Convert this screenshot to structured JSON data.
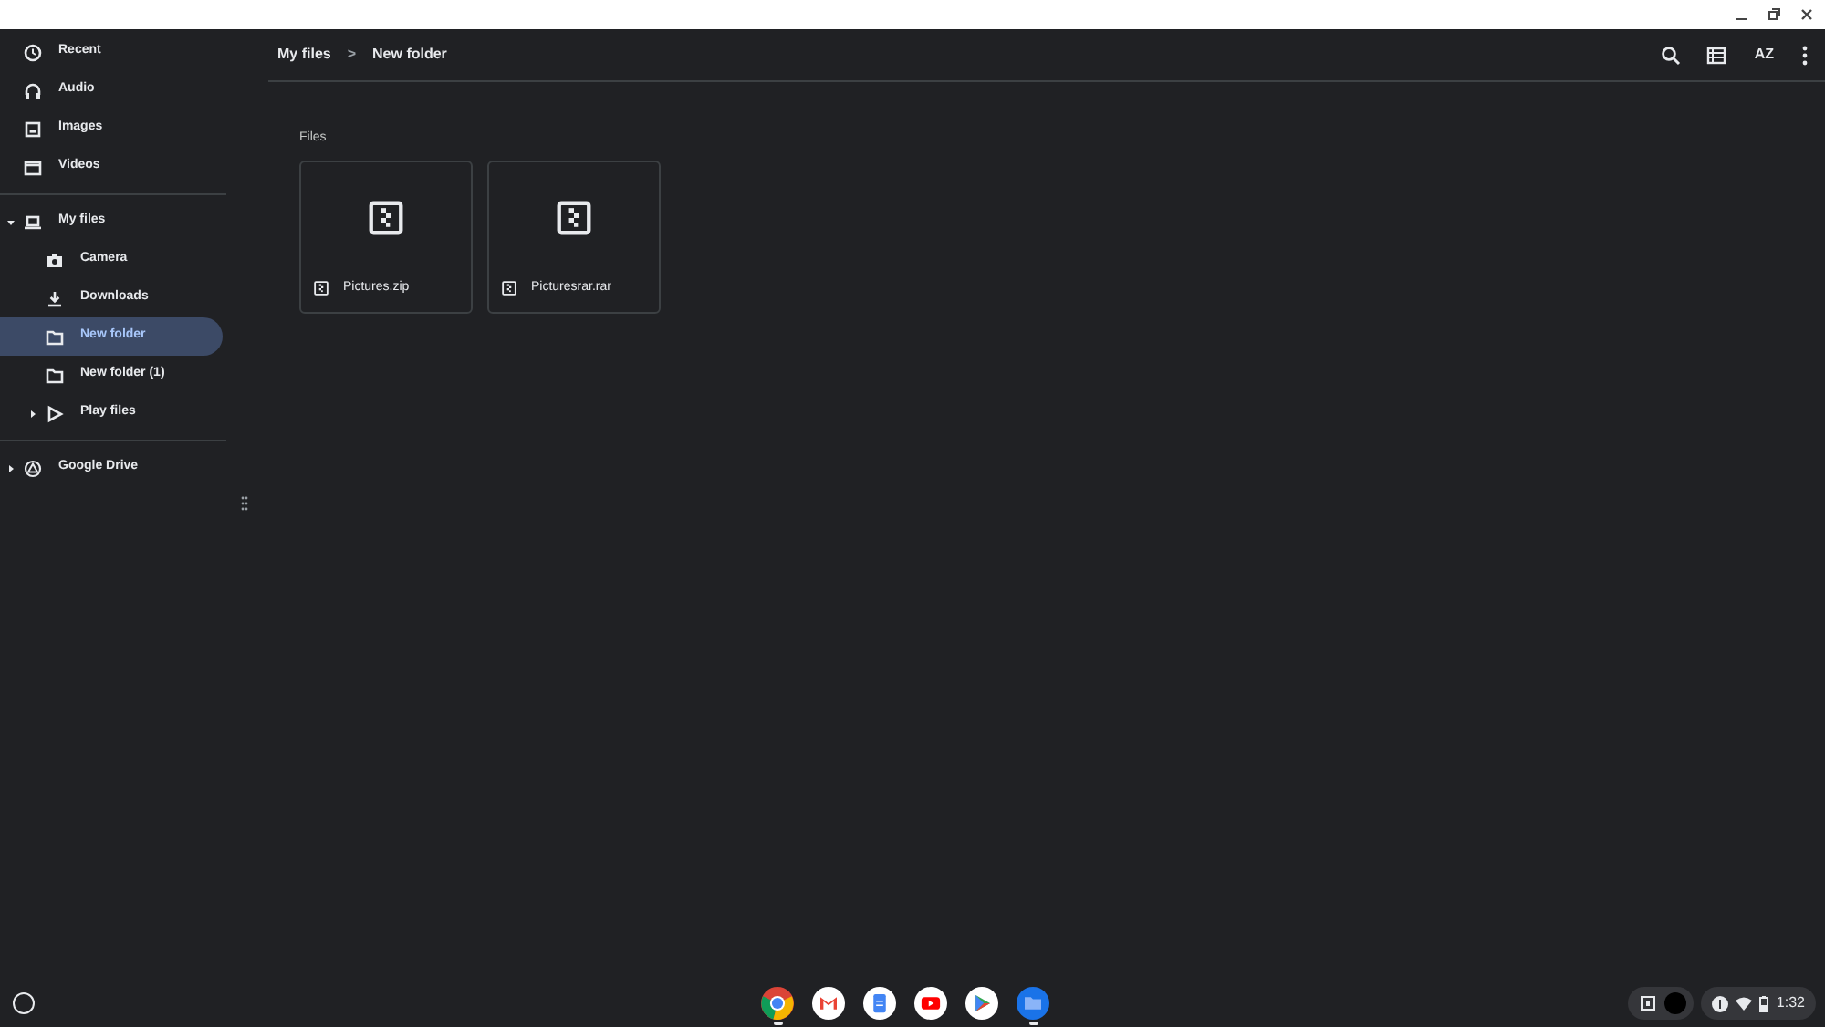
{
  "sidebar": {
    "top_items": [
      {
        "label": "Recent",
        "selected": false
      },
      {
        "label": "Audio",
        "selected": false
      },
      {
        "label": "Images",
        "selected": false
      },
      {
        "label": "Videos",
        "selected": false
      }
    ],
    "tree": [
      {
        "label": "My files",
        "expanded": true,
        "selected": false,
        "children": [
          {
            "label": "Camera",
            "selected": false
          },
          {
            "label": "Downloads",
            "selected": false
          },
          {
            "label": "New folder",
            "selected": true
          },
          {
            "label": "New folder (1)",
            "selected": false
          },
          {
            "label": "Play files",
            "expanded": false,
            "selected": false
          }
        ]
      }
    ],
    "drive": [
      {
        "label": "Google Drive",
        "expanded": false,
        "selected": false
      }
    ]
  },
  "breadcrumb": [
    "My files",
    "New folder"
  ],
  "breadcrumb_separator": ">",
  "toolbar": {
    "sort_label": "AZ"
  },
  "section_title": "Files",
  "files": [
    {
      "name": "Pictures.zip"
    },
    {
      "name": "Picturesrar.rar"
    }
  ],
  "shelf": {
    "apps": [
      {
        "running": true
      },
      {
        "running": false
      },
      {
        "running": false
      },
      {
        "running": false
      },
      {
        "running": false
      },
      {
        "running": true
      }
    ],
    "time": "1:32"
  }
}
